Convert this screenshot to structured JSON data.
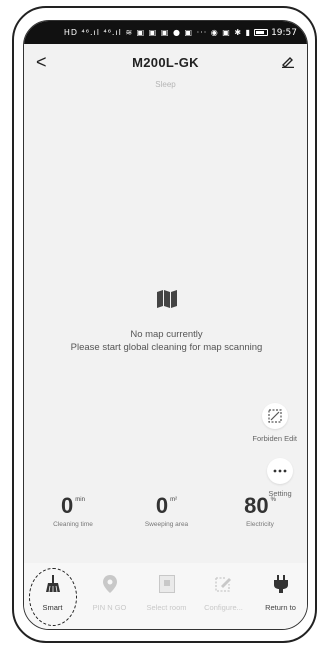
{
  "statusbar": {
    "icons": "HD ⁴⁶.ıl ⁴⁶.ıl ≋ ▣ ▣ ▣ ● ▣ ··· ◉ ▣ ✱ ▮",
    "time": "19:57"
  },
  "appbar": {
    "back_glyph": "<",
    "title": "M200L-GK"
  },
  "device_status": "Sleep",
  "map": {
    "line1": "No map currently",
    "line2": "Please start global cleaning for map scanning"
  },
  "side_buttons": {
    "forbidden_edit": "Forbiden Edit",
    "setting": "Setting"
  },
  "stats": [
    {
      "value": "0",
      "unit": "min",
      "caption": "Cleaning time"
    },
    {
      "value": "0",
      "unit": "m²",
      "caption": "Sweeping area"
    },
    {
      "value": "80",
      "unit": "%",
      "caption": "Electricity"
    }
  ],
  "tabs": [
    {
      "label": "Smart",
      "icon": "broom-icon"
    },
    {
      "label": "PIN N GO",
      "icon": "location-pin-icon"
    },
    {
      "label": "Select room",
      "icon": "room-icon"
    },
    {
      "label": "Configure...",
      "icon": "edit-area-icon"
    },
    {
      "label": "Return to",
      "icon": "plug-icon"
    }
  ],
  "colors": {
    "background": "#f2f2f2",
    "text_dark": "#333333",
    "text_muted": "#c8c8c8"
  }
}
